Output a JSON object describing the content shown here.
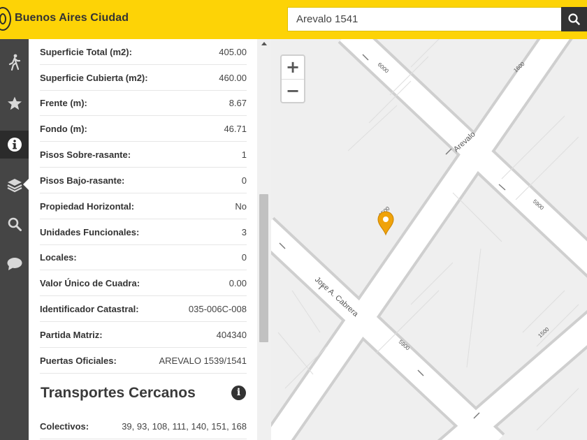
{
  "header": {
    "brand": "Buenos Aires Ciudad",
    "search_value": "Arevalo 1541"
  },
  "rail": {
    "icons": [
      "walking-icon",
      "star-icon",
      "info-icon",
      "layers-icon",
      "search-icon",
      "chat-icon"
    ],
    "active": "info-icon"
  },
  "details": [
    {
      "label": "Superficie Total (m2):",
      "value": "405.00"
    },
    {
      "label": "Superficie Cubierta (m2):",
      "value": "460.00"
    },
    {
      "label": "Frente (m):",
      "value": "8.67"
    },
    {
      "label": "Fondo (m):",
      "value": "46.71"
    },
    {
      "label": "Pisos Sobre-rasante:",
      "value": "1"
    },
    {
      "label": "Pisos Bajo-rasante:",
      "value": "0"
    },
    {
      "label": "Propiedad Horizontal:",
      "value": "No"
    },
    {
      "label": "Unidades Funcionales:",
      "value": "3"
    },
    {
      "label": "Locales:",
      "value": "0"
    },
    {
      "label": "Valor Único de Cuadra:",
      "value": "0.00"
    },
    {
      "label": "Identificador Catastral:",
      "value": "035-006C-008"
    },
    {
      "label": "Partida Matriz:",
      "value": "404340"
    },
    {
      "label": "Puertas Oficiales:",
      "value": "AREVALO 1539/1541"
    }
  ],
  "transport": {
    "title": "Transportes Cercanos",
    "rows": [
      {
        "label": "Colectivos:",
        "value": "39, 93, 108, 111, 140, 151, 168"
      }
    ]
  },
  "map": {
    "zoom_in": "+",
    "zoom_out": "−",
    "street_labels": {
      "arevalo": "Arevalo",
      "cabrera": "Jose A. Cabrera",
      "n6000": "6000",
      "n1600": "1600",
      "n5900a": "5900",
      "n1500a": "1500",
      "n5900b": "5900",
      "n1500b": "1500"
    },
    "marker_color": "#f0a30a"
  }
}
